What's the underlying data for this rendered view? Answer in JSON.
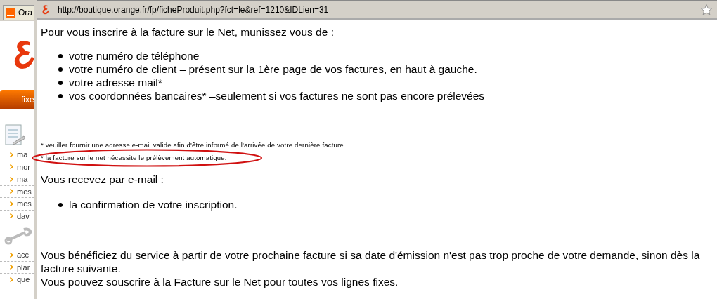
{
  "background_page": {
    "tab_label": "Ora",
    "side_button": "fixe",
    "menu_groups": [
      {
        "kind": "document",
        "items": [
          "ma",
          "mor",
          "ma",
          "mes",
          "mes",
          "dav"
        ]
      },
      {
        "kind": "wrench",
        "items": [
          "acc",
          "plar",
          "que"
        ]
      }
    ]
  },
  "popup": {
    "url": "http://boutique.orange.fr/fp/ficheProduit.php?fct=le&ref=1210&IDLien=31",
    "intro": "Pour vous inscrire à la facture sur le Net, munissez vous de :",
    "requirements": [
      "votre numéro de téléphone",
      "votre numéro de client – présent sur la 1ère page de vos factures, en haut à gauche.",
      "votre adresse mail*",
      "vos coordonnées bancaires* –seulement si vos factures ne sont pas encore prélevées"
    ],
    "footnotes": [
      {
        "text": "* veuiller fournir une adresse e-mail valide afin d'être informé de l'arrivée de votre dernière facture",
        "circled": false
      },
      {
        "text": "* la facture sur le net nécessite le prélèvement automatique.",
        "circled": true
      }
    ],
    "receive_heading": "Vous recevez par e-mail :",
    "receive_items": [
      "la confirmation de votre inscription."
    ],
    "closing_paragraphs": [
      "Vous bénéficiez du service à partir de votre prochaine facture si sa date d'émission n'est pas trop proche de votre demande, sinon dès la facture suivante.",
      "Vous pouvez souscrire à la Facture sur le Net pour toutes vos lignes fixes."
    ]
  }
}
